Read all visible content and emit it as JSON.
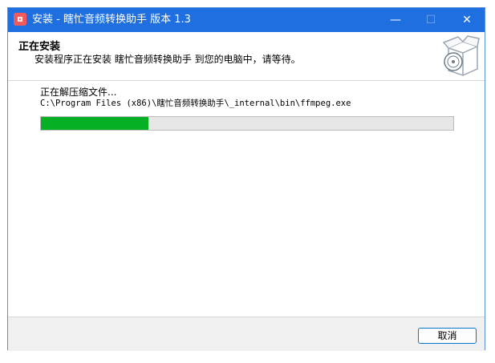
{
  "window": {
    "title": "安装 - 瞎忙音频转换助手 版本 1.3",
    "controls": {
      "minimize": "—",
      "maximize": "☐",
      "close": "✕"
    }
  },
  "header": {
    "title": "正在安装",
    "subtitle": "安装程序正在安装 瞎忙音频转换助手 到您的电脑中，请等待。",
    "art_icon": "installer-box-icon"
  },
  "content": {
    "status": "正在解压缩文件...",
    "current_file": "C:\\Program Files (x86)\\瞎忙音频转换助手\\_internal\\bin\\ffmpeg.exe",
    "progress_percent": 26
  },
  "footer": {
    "cancel_label": "取消"
  },
  "colors": {
    "titlebar": "#1f6fe0",
    "progress_fill": "#06b025",
    "button_border": "#0078d4"
  }
}
